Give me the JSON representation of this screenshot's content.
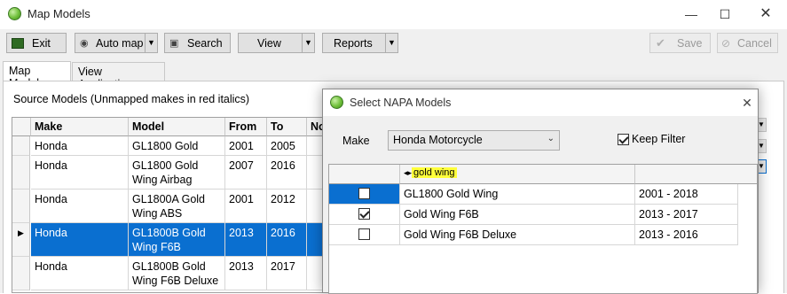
{
  "window": {
    "title": "Map Models"
  },
  "toolbar": {
    "exit": "Exit",
    "auto_map": "Auto map",
    "search": "Search",
    "view": "View",
    "reports": "Reports",
    "save": "Save",
    "cancel": "Cancel"
  },
  "tabs": [
    {
      "label": "Map Models"
    },
    {
      "label": "View Applications"
    }
  ],
  "source": {
    "label": "Source Models (Unmapped makes in red italics)",
    "columns": [
      "Make",
      "Model",
      "From",
      "To",
      "No"
    ],
    "rows": [
      {
        "make": "Honda",
        "model": "GL1800 Gold Wing",
        "from": "2001",
        "to": "2005"
      },
      {
        "make": "Honda",
        "model": "GL1800 Gold Wing Airbag",
        "from": "2007",
        "to": "2016"
      },
      {
        "make": "Honda",
        "model": "GL1800A Gold Wing ABS",
        "from": "2001",
        "to": "2012"
      },
      {
        "make": "Honda",
        "model": "GL1800B Gold Wing F6B",
        "from": "2013",
        "to": "2016"
      },
      {
        "make": "Honda",
        "model": "GL1800B Gold Wing F6B Deluxe",
        "from": "2013",
        "to": "2017"
      }
    ]
  },
  "dialog": {
    "title": "Select NAPA Models",
    "make_label": "Make",
    "make_value": "Honda Motorcycle",
    "keep_filter": "Keep Filter",
    "filter_text": "gold wing",
    "rows": [
      {
        "name": "GL1800 Gold Wing",
        "years": "2001 - 2018",
        "checked": false
      },
      {
        "name": "Gold Wing F6B",
        "years": "2013 - 2017",
        "checked": true
      },
      {
        "name": "Gold Wing F6B Deluxe",
        "years": "2013 - 2016",
        "checked": false
      }
    ]
  },
  "colors": {
    "selection": "#0a6fd0",
    "filter_highlight": "#ffff3a"
  }
}
